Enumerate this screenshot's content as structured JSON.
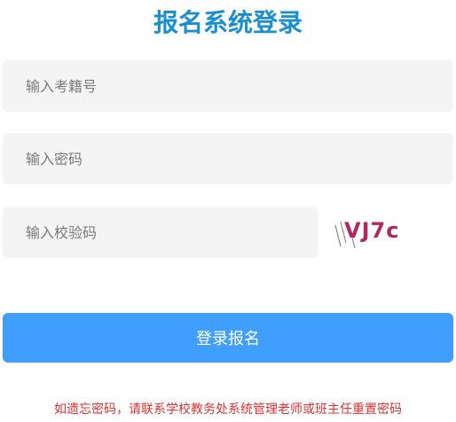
{
  "page": {
    "title": "报名系统登录"
  },
  "form": {
    "username": {
      "placeholder": "输入考籍号",
      "value": ""
    },
    "password": {
      "placeholder": "输入密码",
      "value": ""
    },
    "verify_code": {
      "placeholder": "输入校验码",
      "value": ""
    },
    "captcha_text": "VJ7c",
    "submit_label": "登录报名"
  },
  "notice": {
    "text": "如遗忘密码，请联系学校教务处系统管理老师或班主任重置密码"
  },
  "colors": {
    "title": "#1a8fd0",
    "button": "#409eff",
    "notice": "#e03030",
    "captcha": "#b0285f"
  }
}
